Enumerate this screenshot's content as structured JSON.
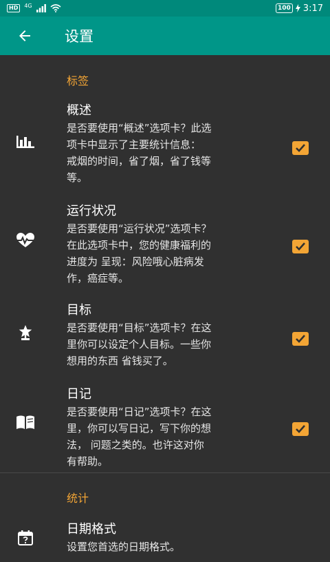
{
  "status_bar": {
    "hd": "HD",
    "network": "4G",
    "battery": "100",
    "time": "3:17"
  },
  "app_bar": {
    "title": "设置",
    "back_icon": "arrow-back-icon"
  },
  "sections": [
    {
      "header": "标签",
      "items": [
        {
          "icon": "bar-chart-icon",
          "title": "概述",
          "summary_lines": [
            "是否要使用“概述”选项卡？此选",
            "项卡中显示了主要统计信息：",
            "戒烟的时间，省了烟，省了钱等",
            "等。"
          ],
          "checked": true
        },
        {
          "icon": "heart-pulse-icon",
          "title": "运行状况",
          "summary_lines": [
            "是否要使用“运行状况”选项卡？",
            "在此选项卡中，您的健康福利的",
            "进度为 呈现：风险哦心脏病发",
            "作，癌症等。"
          ],
          "checked": true
        },
        {
          "icon": "trophy-star-icon",
          "title": "目标",
          "summary_lines": [
            "是否要使用“目标”选项卡？在这",
            "里你可以设定个人目标。一些你",
            "想用的东西 省钱买了。"
          ],
          "checked": true
        },
        {
          "icon": "open-book-icon",
          "title": "日记",
          "summary_lines": [
            "是否要使用“日记”选项卡？在这",
            "里，你可以写日记，写下你的想",
            "法， 问题之类的。也许这对你",
            "有帮助。"
          ],
          "checked": true
        }
      ]
    },
    {
      "header": "统计",
      "items": [
        {
          "icon": "calendar-question-icon",
          "title": "日期格式",
          "summary_lines": [
            "设置您首选的日期格式。"
          ]
        }
      ]
    }
  ]
}
